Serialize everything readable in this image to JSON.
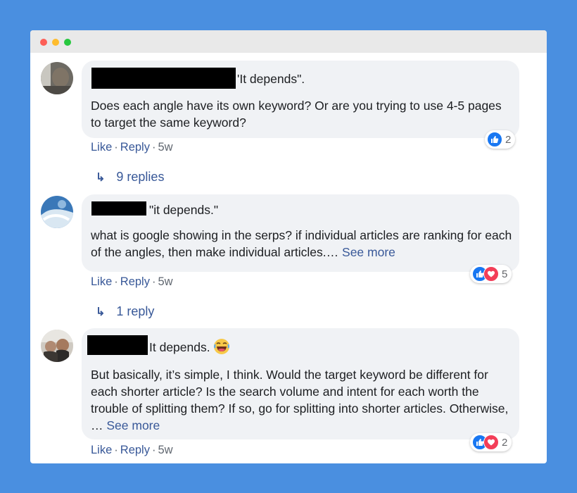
{
  "comments": [
    {
      "name_suffix": "'It depends\".",
      "body": "Does each angle have its own keyword? Or are you trying to use 4-5 pages to target the same keyword?",
      "see_more": "",
      "actions": {
        "like": "Like",
        "reply": "Reply",
        "time": "5w"
      },
      "reactions": {
        "types": [
          "like"
        ],
        "count": "2"
      },
      "replies": "9 replies"
    },
    {
      "name_suffix": "\"it depends.\"",
      "body": "what is google showing in the serps? if individual articles are ranking for each of the angles, then make individual articles.…",
      "see_more": "See more",
      "actions": {
        "like": "Like",
        "reply": "Reply",
        "time": "5w"
      },
      "reactions": {
        "types": [
          "like",
          "love"
        ],
        "count": "5"
      },
      "replies": "1 reply"
    },
    {
      "name_suffix": "It depends.",
      "body": "But basically, it’s simple, I think. Would the target keyword be different for each shorter article? Is the search volume and intent for each worth the trouble of splitting them? If so, go for splitting into shorter articles. Otherwise, …",
      "see_more": "See more",
      "actions": {
        "like": "Like",
        "reply": "Reply",
        "time": "5w"
      },
      "reactions": {
        "types": [
          "like",
          "love"
        ],
        "count": "2"
      },
      "replies": ""
    }
  ],
  "colors": {
    "background": "#4a8fe0",
    "bubble": "#f0f2f5",
    "link": "#385898",
    "like": "#1877f2",
    "love": "#f33e58"
  },
  "icons": {
    "reply_arrow": "reply-arrow-icon",
    "like": "like-icon",
    "love": "love-icon",
    "laugh": "laughing-emoji-icon"
  }
}
